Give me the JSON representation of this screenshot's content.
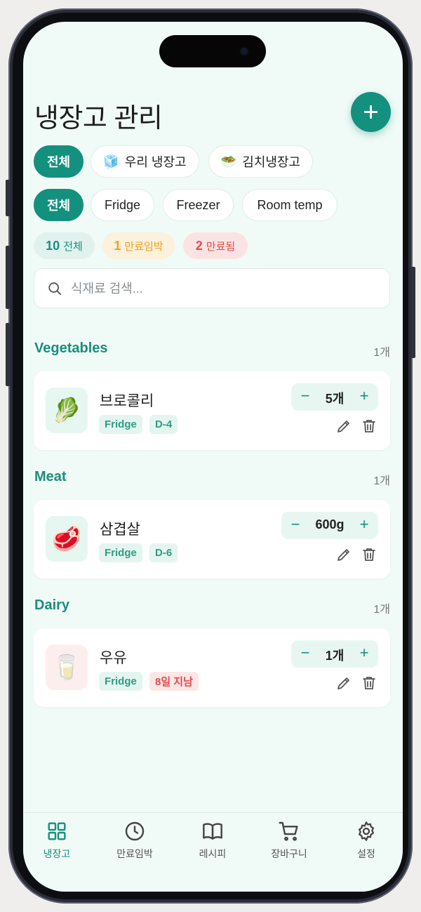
{
  "header": {
    "title": "냉장고 관리"
  },
  "fridge_filters": [
    {
      "label": "전체",
      "icon": "",
      "active": true
    },
    {
      "label": "우리 냉장고",
      "icon": "🧊",
      "active": false
    },
    {
      "label": "김치냉장고",
      "icon": "🥗",
      "active": false
    }
  ],
  "location_filters": [
    {
      "label": "전체",
      "active": true
    },
    {
      "label": "Fridge",
      "active": false
    },
    {
      "label": "Freezer",
      "active": false
    },
    {
      "label": "Room temp",
      "active": false
    }
  ],
  "stats": {
    "total": {
      "count": "10",
      "label": "전체",
      "color": "#1b8e7d"
    },
    "expiring": {
      "count": "1",
      "label": "만료임박",
      "color": "#f0a020"
    },
    "expired": {
      "count": "2",
      "label": "만료됨",
      "color": "#e24c4c"
    }
  },
  "search": {
    "placeholder": "식재료 검색..."
  },
  "sections": [
    {
      "title": "Vegetables",
      "count": "1개",
      "item": {
        "name": "브로콜리",
        "icon": "🥬",
        "location": "Fridge",
        "days": "D-4",
        "quantity": "5개",
        "expired": false
      }
    },
    {
      "title": "Meat",
      "count": "1개",
      "item": {
        "name": "삼겹살",
        "icon": "🥩",
        "location": "Fridge",
        "days": "D-6",
        "quantity": "600g",
        "expired": false
      }
    },
    {
      "title": "Dairy",
      "count": "1개",
      "item": {
        "name": "우유",
        "icon": "🥛",
        "location": "Fridge",
        "days": "8일 지남",
        "quantity": "1개",
        "expired": true
      }
    }
  ],
  "tabbar": [
    {
      "label": "냉장고",
      "icon": "grid-icon",
      "active": true
    },
    {
      "label": "만료임박",
      "icon": "clock-icon",
      "active": false
    },
    {
      "label": "레시피",
      "icon": "book-icon",
      "active": false
    },
    {
      "label": "장바구니",
      "icon": "cart-icon",
      "active": false
    },
    {
      "label": "설정",
      "icon": "gear-icon",
      "active": false
    }
  ],
  "colors": {
    "accent": "#14907e",
    "background": "#f0faf7",
    "danger": "#e24c4c",
    "warning": "#f0a020"
  }
}
